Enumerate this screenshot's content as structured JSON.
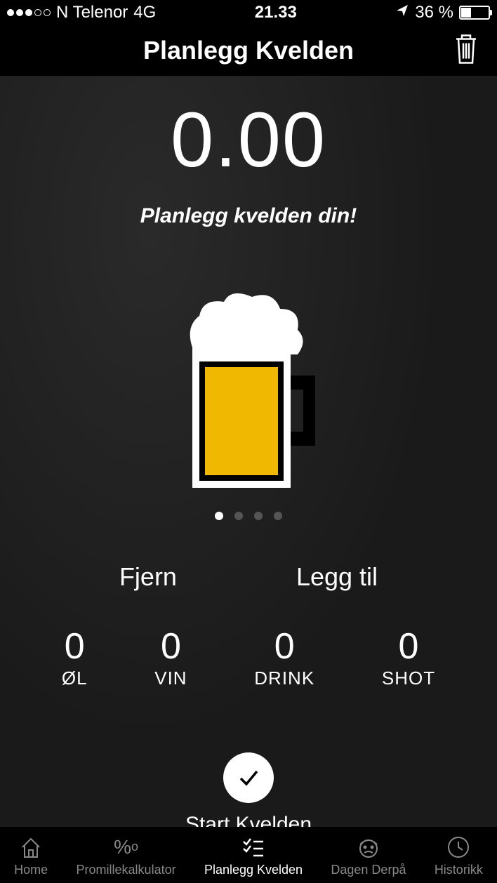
{
  "status": {
    "carrier": "N Telenor",
    "network": "4G",
    "time": "21.33",
    "battery_pct": "36 %"
  },
  "header": {
    "title": "Planlegg Kvelden"
  },
  "main": {
    "promille": "0.00",
    "subtitle": "Planlegg kvelden din!",
    "page_index": 0,
    "page_count": 4
  },
  "actions": {
    "remove": "Fjern",
    "add": "Legg til"
  },
  "counters": [
    {
      "value": "0",
      "label": "ØL"
    },
    {
      "value": "0",
      "label": "VIN"
    },
    {
      "value": "0",
      "label": "DRINK"
    },
    {
      "value": "0",
      "label": "SHOT"
    }
  ],
  "start": {
    "label": "Start Kvelden"
  },
  "tabs": [
    {
      "label": "Home",
      "icon": "home",
      "active": false
    },
    {
      "label": "Promillekalkulator",
      "icon": "promille",
      "active": false
    },
    {
      "label": "Planlegg Kvelden",
      "icon": "checklist",
      "active": true
    },
    {
      "label": "Dagen Derpå",
      "icon": "face",
      "active": false
    },
    {
      "label": "Historikk",
      "icon": "clock",
      "active": false
    }
  ]
}
